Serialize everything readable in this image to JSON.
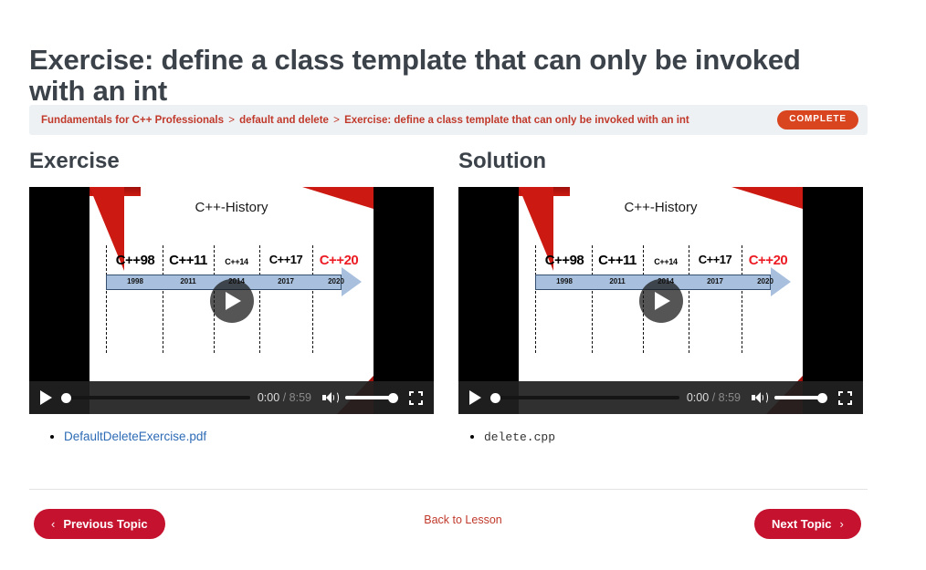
{
  "page": {
    "title": "Exercise: define a class template that can only be invoked with an int"
  },
  "breadcrumb": {
    "items": [
      "Fundamentals for C++ Professionals",
      "default and delete",
      "Exercise: define a class template that can only be invoked with an int"
    ],
    "separator": ">",
    "status_badge": "COMPLETE",
    "badge_color": "#d9451f",
    "link_color": "#c0392b",
    "bar_background": "#eef1f4"
  },
  "columns": [
    {
      "heading": "Exercise",
      "video": {
        "slide_title": "C++-History",
        "play_overlay_icon": "play-icon",
        "controls": {
          "play_icon": "play-icon",
          "current_time": "0:00",
          "time_separator": "/",
          "duration": "8:59",
          "volume_icon": "volume-high-icon",
          "fullscreen_icon": "fullscreen-icon",
          "seek_progress_percent": 0,
          "volume_percent": 100
        }
      },
      "files": [
        {
          "label": "DefaultDeleteExercise.pdf",
          "style": "link"
        }
      ]
    },
    {
      "heading": "Solution",
      "video": {
        "slide_title": "C++-History",
        "play_overlay_icon": "play-icon",
        "controls": {
          "play_icon": "play-icon",
          "current_time": "0:00",
          "time_separator": "/",
          "duration": "8:59",
          "volume_icon": "volume-high-icon",
          "fullscreen_icon": "fullscreen-icon",
          "seek_progress_percent": 0,
          "volume_percent": 100
        }
      },
      "files": [
        {
          "label": "delete.cpp",
          "style": "mono"
        }
      ]
    }
  ],
  "chart_data": {
    "type": "bar",
    "title": "C++-History",
    "xlabel": "",
    "ylabel": "",
    "categories": [
      "C++98",
      "C++11",
      "C++14",
      "C++17",
      "C++20"
    ],
    "values": [
      1998,
      2011,
      2014,
      2017,
      2020
    ],
    "tick_labels": [
      "1998",
      "2011",
      "2014",
      "2017",
      "2020"
    ],
    "emphasis": {
      "category": "C++20",
      "color": "#ec1c24"
    },
    "bar_color": "#a8c0de",
    "bar_border_color": "#35506f",
    "grid": true,
    "legend": "none"
  },
  "footer": {
    "previous_label": "Previous Topic",
    "previous_chevron": "chevron-left-icon",
    "back_label": "Back to Lesson",
    "next_label": "Next Topic",
    "next_chevron": "chevron-right-icon",
    "button_color": "#c4122f"
  }
}
